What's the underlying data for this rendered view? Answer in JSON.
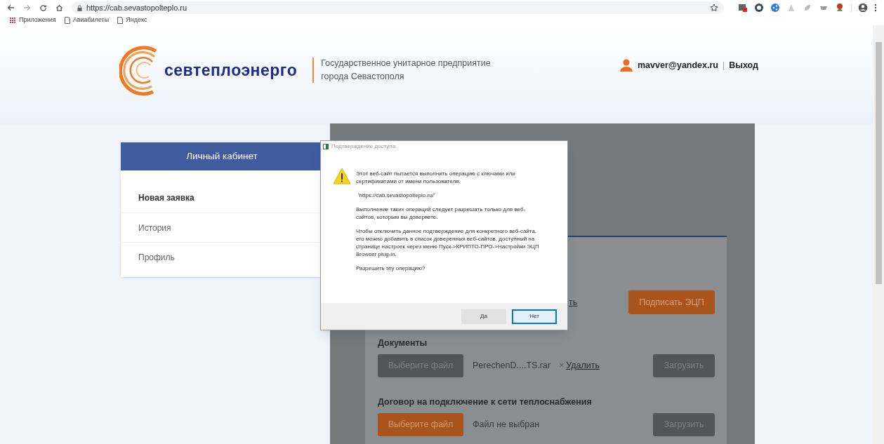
{
  "browser": {
    "url": "https://cab.sevastopolteplo.ru",
    "bookmarks": [
      {
        "label": "Приложения",
        "kind": "apps"
      },
      {
        "label": "Авиабилеты",
        "kind": "page"
      },
      {
        "label": "Яндекс",
        "kind": "page"
      }
    ]
  },
  "header": {
    "brand": "севтеплоэнерго",
    "tagline": [
      "Государственное унитарное предприятие",
      "города Севастополя"
    ],
    "user_email": "mavver@yandex.ru",
    "separator": "|",
    "logout": "Выход"
  },
  "sidebar": {
    "title": "Личный кабинет",
    "items": [
      {
        "label": "Новая заявка",
        "selected": true
      },
      {
        "label": "История",
        "selected": false
      },
      {
        "label": "Профиль",
        "selected": false
      }
    ]
  },
  "main": {
    "partial_link": "ть",
    "sign_button": "Подписать ЭЦП",
    "sections": [
      {
        "title": "Документы",
        "file_button": {
          "label": "Выберите файл",
          "highlighted": false
        },
        "file_name": "PerechenD....TS.rar",
        "remove": {
          "icon": "×",
          "label": "Удалить"
        },
        "upload_button": "Загрузить"
      },
      {
        "title": "Договор на подключение к сети теплоснабжения",
        "file_button": {
          "label": "Выберите файл",
          "highlighted": true
        },
        "file_name": "Файл не выбран",
        "upload_button": "Загрузить"
      }
    ]
  },
  "dialog": {
    "title": "Подтверждение доступа",
    "paragraphs": [
      "Этот веб-сайт пытается выполнить операцию с ключами или сертификатами от имени пользователя.",
      "'https://cab.sevastopolteplo.ru/'",
      "Выполнение таких операций следует разрешать только для веб-сайтов, которым вы доверяете.",
      "Чтобы отключить данное подтверждение для конкретного веб-сайта, его можно добавить в список доверенных веб-сайтов, доступный на странице настроек через меню Пуск->КРИПТО-ПРО->Настройки ЭЦП Browser plug-in.",
      "Разрешить эту операцию?"
    ],
    "buttons": [
      {
        "label": "Да",
        "focused": false
      },
      {
        "label": "Нет",
        "focused": true
      }
    ]
  }
}
